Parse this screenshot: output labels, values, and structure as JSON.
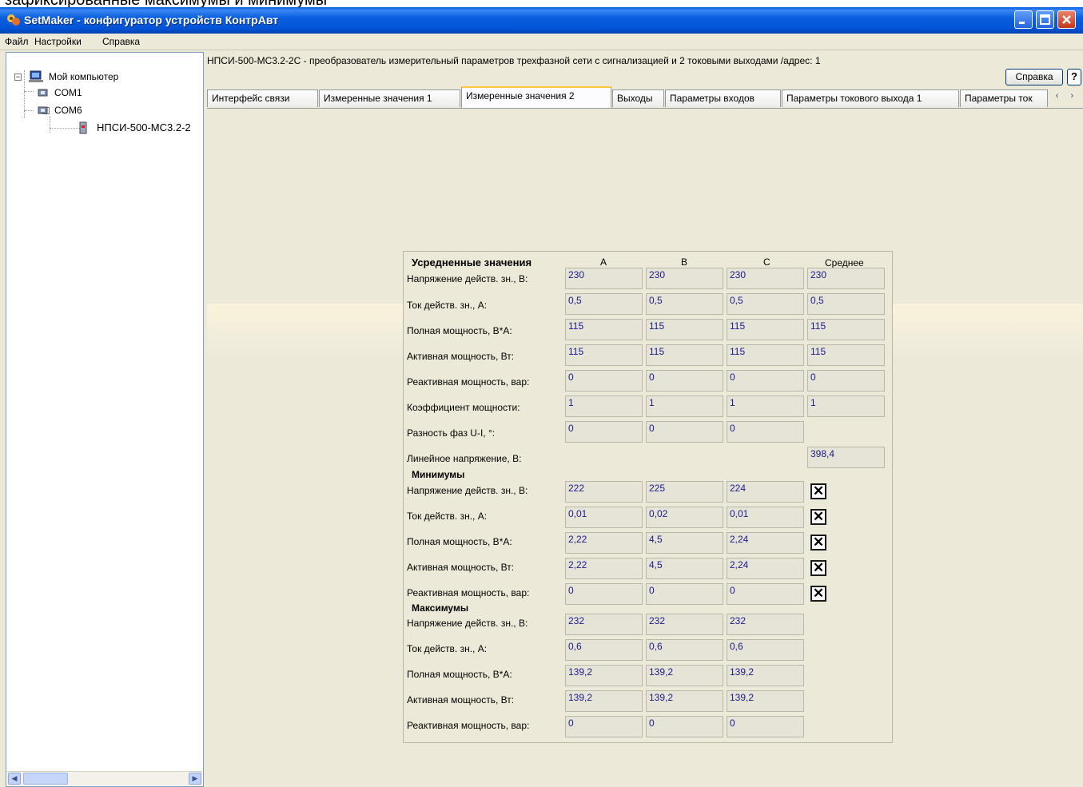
{
  "caption": "зафиксированные максимумы и минимумы",
  "window": {
    "title": "SetMaker - конфигуратор устройств КонтрАвт"
  },
  "menu": [
    "Файл",
    "Настройки",
    "Справка"
  ],
  "tree": {
    "root": "Мой компьютер",
    "ports": [
      "COM1",
      "COM6"
    ],
    "device": "НПСИ-500-МС3.2-2"
  },
  "device_title": "НПСИ-500-МС3.2-2С - преобразователь измерительный параметров трехфазной сети с сигнализацией и 2 токовыми выходами /адрес: 1",
  "help_label": "Справка",
  "question_label": "?",
  "tabs": [
    "Интерфейс связи",
    "Измеренные значения 1",
    "Измеренные значения 2",
    "Выходы",
    "Параметры входов",
    "Параметры токового выхода 1",
    "Параметры ток"
  ],
  "active_tab": "Измеренные значения 2",
  "tab_scroll": "‹ ›",
  "headers": {
    "section": "Усредненные значения",
    "a": "A",
    "b": "B",
    "c": "C",
    "avg": "Среднее"
  },
  "averaged": [
    {
      "label": "Напряжение действ. зн., В:",
      "a": "230",
      "b": "230",
      "c": "230",
      "avg": "230"
    },
    {
      "label": "Ток действ. зн., А:",
      "a": "0,5",
      "b": "0,5",
      "c": "0,5",
      "avg": "0,5"
    },
    {
      "label": "Полная мощность, В*А:",
      "a": "115",
      "b": "115",
      "c": "115",
      "avg": "115"
    },
    {
      "label": "Активная мощность, Вт:",
      "a": "115",
      "b": "115",
      "c": "115",
      "avg": "115"
    },
    {
      "label": "Реактивная мощность, вар:",
      "a": "0",
      "b": "0",
      "c": "0",
      "avg": "0"
    },
    {
      "label": "Коэффициент мощности:",
      "a": "1",
      "b": "1",
      "c": "1",
      "avg": "1"
    },
    {
      "label": "Разность фаз U-I, °:",
      "a": "0",
      "b": "0",
      "c": "0"
    }
  ],
  "line_voltage": {
    "label": "Линейное напряжение, В:",
    "value": "398,4"
  },
  "minimums": {
    "title": "Минимумы",
    "rows": [
      {
        "label": "Напряжение действ. зн., В:",
        "a": "222",
        "b": "225",
        "c": "224"
      },
      {
        "label": "Ток действ. зн., А:",
        "a": "0,01",
        "b": "0,02",
        "c": "0,01"
      },
      {
        "label": "Полная мощность, В*А:",
        "a": "2,22",
        "b": "4,5",
        "c": "2,24"
      },
      {
        "label": "Активная мощность, Вт:",
        "a": "2,22",
        "b": "4,5",
        "c": "2,24"
      },
      {
        "label": "Реактивная мощность, вар:",
        "a": "0",
        "b": "0",
        "c": "0"
      }
    ]
  },
  "maximums": {
    "title": "Максимумы",
    "rows": [
      {
        "label": "Напряжение действ. зн., В:",
        "a": "232",
        "b": "232",
        "c": "232"
      },
      {
        "label": "Ток действ. зн., А:",
        "a": "0,6",
        "b": "0,6",
        "c": "0,6"
      },
      {
        "label": "Полная мощность, В*А:",
        "a": "139,2",
        "b": "139,2",
        "c": "139,2"
      },
      {
        "label": "Активная мощность, Вт:",
        "a": "139,2",
        "b": "139,2",
        "c": "139,2"
      },
      {
        "label": "Реактивная мощность, вар:",
        "a": "0",
        "b": "0",
        "c": "0"
      }
    ]
  },
  "reset_glyph": "✕"
}
